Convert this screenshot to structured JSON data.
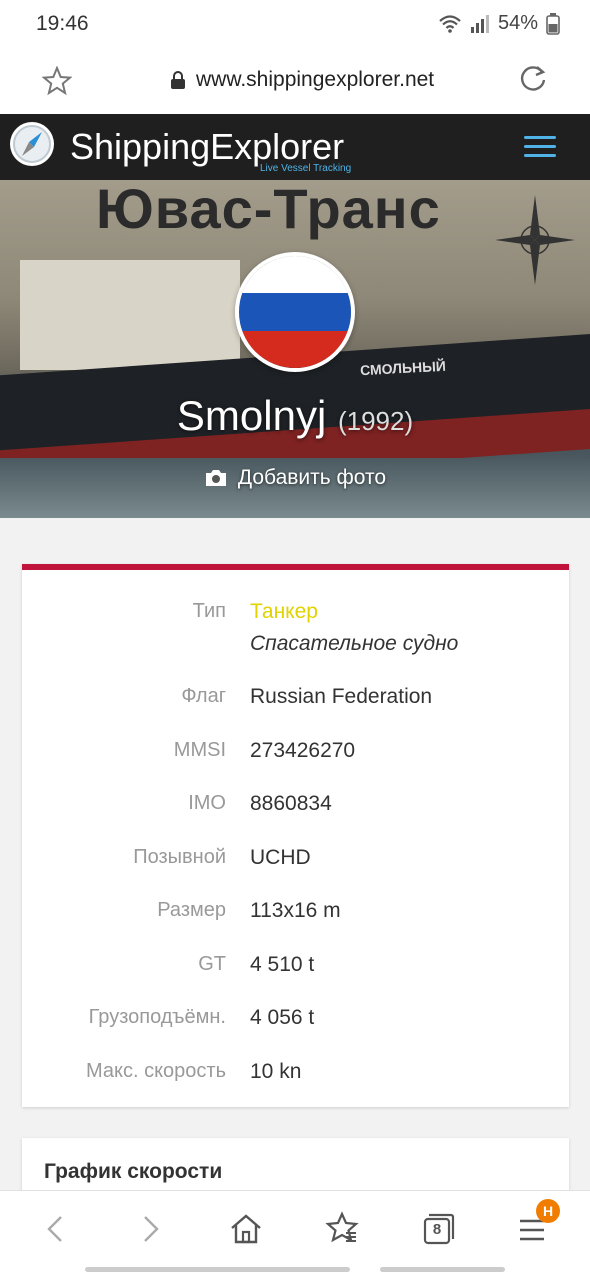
{
  "status": {
    "time": "19:46",
    "battery": "54%"
  },
  "browser": {
    "url": "www.shippingexplorer.net",
    "tabs_count": "8",
    "menu_badge": "Н"
  },
  "site": {
    "brand": "ShippingExplorer",
    "tagline": "Live Vessel Tracking"
  },
  "hero": {
    "banner_text": "Ювас-Транс",
    "hull_text": "СМОЛЬНЫЙ",
    "vessel_name": "Smolnyj",
    "year": "(1992)",
    "add_photo": "Добавить фото",
    "flag_colors": [
      "#ffffff",
      "#1c55b8",
      "#d52b1e"
    ]
  },
  "details": {
    "type_label": "Тип",
    "type_value": "Танкер",
    "type_sub": "Спасательное судно",
    "type_color": "#e0d300",
    "flag_label": "Флаг",
    "flag_value": "Russian Federation",
    "mmsi_label": "MMSI",
    "mmsi_value": "273426270",
    "imo_label": "IMO",
    "imo_value": "8860834",
    "callsign_label": "Позывной",
    "callsign_value": "UCHD",
    "size_label": "Размер",
    "size_value": "113x16 m",
    "gt_label": "GT",
    "gt_value": "4 510 t",
    "dwt_label": "Грузоподъёмн.",
    "dwt_value": "4 056 t",
    "speed_label": "Макс. скорость",
    "speed_value": "10 kn"
  },
  "speed_chart": {
    "title": "График скорости"
  },
  "accent_color": "#c0143c"
}
